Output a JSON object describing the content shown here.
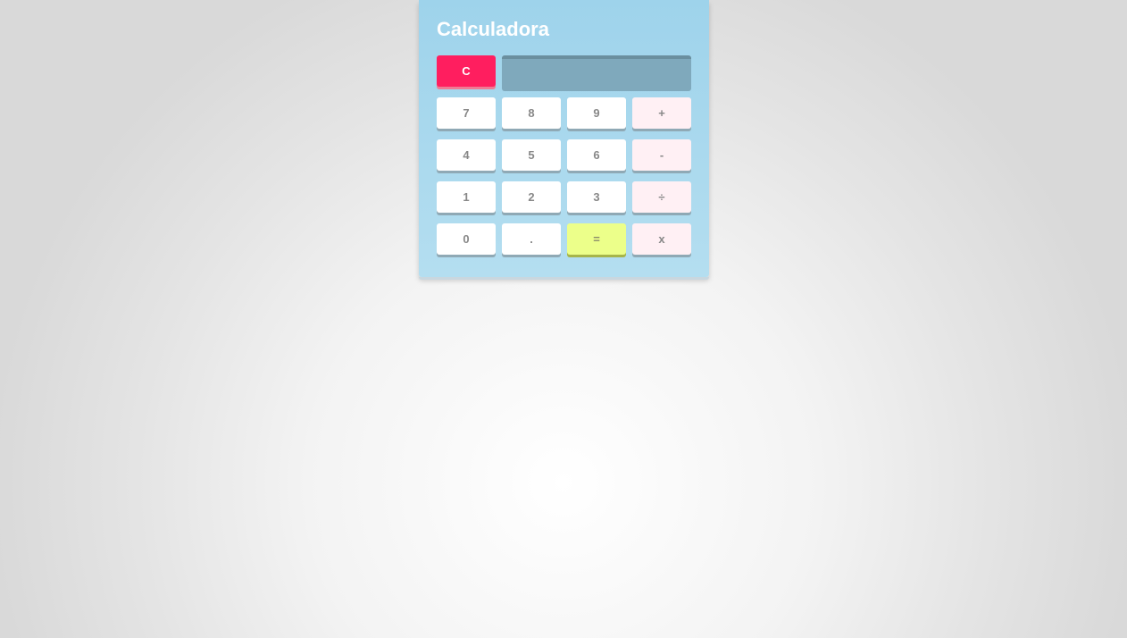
{
  "calculator": {
    "title": "Calculadora",
    "screen_value": "",
    "keys": {
      "clear": "C",
      "seven": "7",
      "eight": "8",
      "nine": "9",
      "plus": "+",
      "four": "4",
      "five": "5",
      "six": "6",
      "minus": "-",
      "one": "1",
      "two": "2",
      "three": "3",
      "divide": "÷",
      "zero": "0",
      "decimal": ".",
      "equals": "=",
      "multiply": "x"
    }
  },
  "colors": {
    "panel": "#9ed3eb",
    "clear_key": "#ff1e5f",
    "operator_key": "#fff0f4",
    "equals_key": "#ecff8a",
    "screen": "#7fa9bc"
  }
}
